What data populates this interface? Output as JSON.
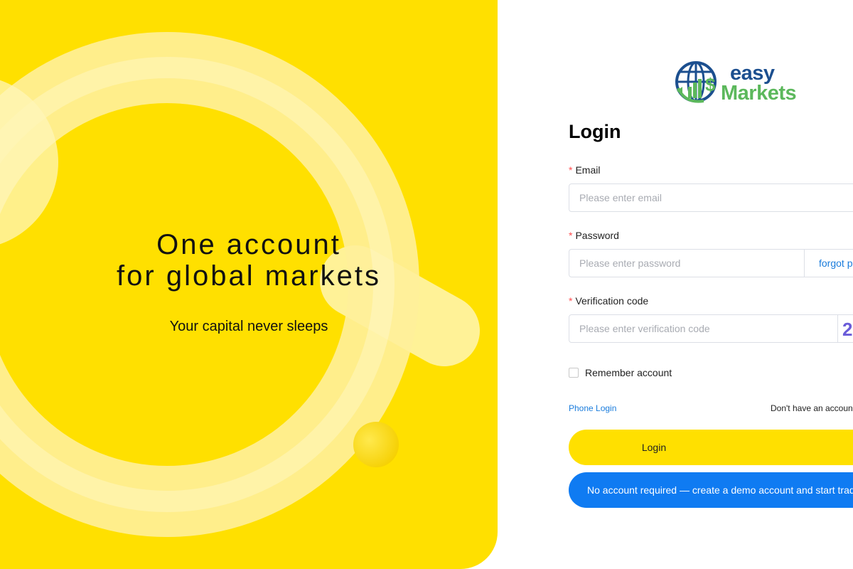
{
  "hero": {
    "title_line1": "One account",
    "title_line2": "for global markets",
    "subtitle": "Your capital never sleeps"
  },
  "brand": {
    "logo_word1": "easy",
    "logo_word2": "Markets",
    "logo_icon": "globe-dollar-icon",
    "colors": {
      "yellow": "#ffe000",
      "navy": "#1c4f8f",
      "green": "#5cb85c",
      "blue": "#0f7bf2"
    }
  },
  "login": {
    "title": "Login",
    "required_mark": "*",
    "email_label": "Email",
    "email_placeholder": "Please enter email",
    "password_label": "Password",
    "password_placeholder": "Please enter password",
    "forgot_label": "forgot password",
    "code_label": "Verification code",
    "code_placeholder": "Please enter verification code",
    "captcha_text": "2",
    "remember_label": "Remember account",
    "phone_login_label": "Phone Login",
    "no_account_label": "Don't have an account",
    "login_button_label": "Login",
    "demo_button_label": "No account required — create a demo account and start trading"
  }
}
